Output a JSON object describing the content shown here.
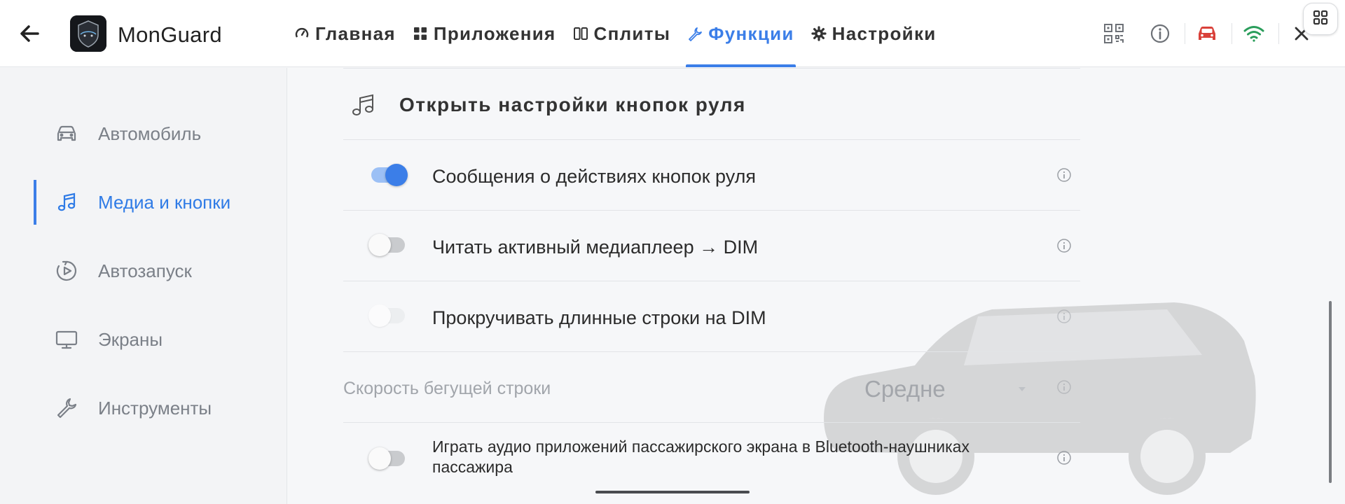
{
  "app": {
    "title": "MonGuard"
  },
  "nav": {
    "tabs": [
      {
        "label": "Главная",
        "icon": "gauge-icon",
        "active": false
      },
      {
        "label": "Приложения",
        "icon": "grid-icon",
        "active": false
      },
      {
        "label": "Сплиты",
        "icon": "split-icon",
        "active": false
      },
      {
        "label": "Функции",
        "icon": "wrench-icon",
        "active": true
      },
      {
        "label": "Настройки",
        "icon": "gear-icon",
        "active": false
      }
    ]
  },
  "status_icons": [
    "qr-code-icon",
    "info-icon",
    "car-icon",
    "wifi-icon",
    "close-icon"
  ],
  "colors": {
    "accent": "#3b7ee8",
    "car_status": "#d9413a",
    "wifi": "#2a9d5b"
  },
  "sidebar": {
    "items": [
      {
        "label": "Автомобиль",
        "icon": "car-icon",
        "active": false
      },
      {
        "label": "Медиа и кнопки",
        "icon": "music-note-icon",
        "active": true
      },
      {
        "label": "Автозапуск",
        "icon": "autostart-icon",
        "active": false
      },
      {
        "label": "Экраны",
        "icon": "monitor-icon",
        "active": false
      },
      {
        "label": "Инструменты",
        "icon": "wrench-icon",
        "active": false
      }
    ]
  },
  "content": {
    "section_title": "Открыть настройки кнопок руля",
    "rows": [
      {
        "label": "Сообщения о действиях кнопок руля",
        "state": "on"
      },
      {
        "label": "Читать активный медиаплеер → DIM",
        "state": "off"
      },
      {
        "label": "Прокручивать длинные строки на DIM",
        "state": "disabled"
      }
    ],
    "speed": {
      "label": "Скорость бегущей строки",
      "value": "Средне"
    },
    "passenger_audio": {
      "label": "Играть аудио приложений пассажирского экрана в Bluetooth-наушниках пассажира",
      "state": "off"
    }
  }
}
